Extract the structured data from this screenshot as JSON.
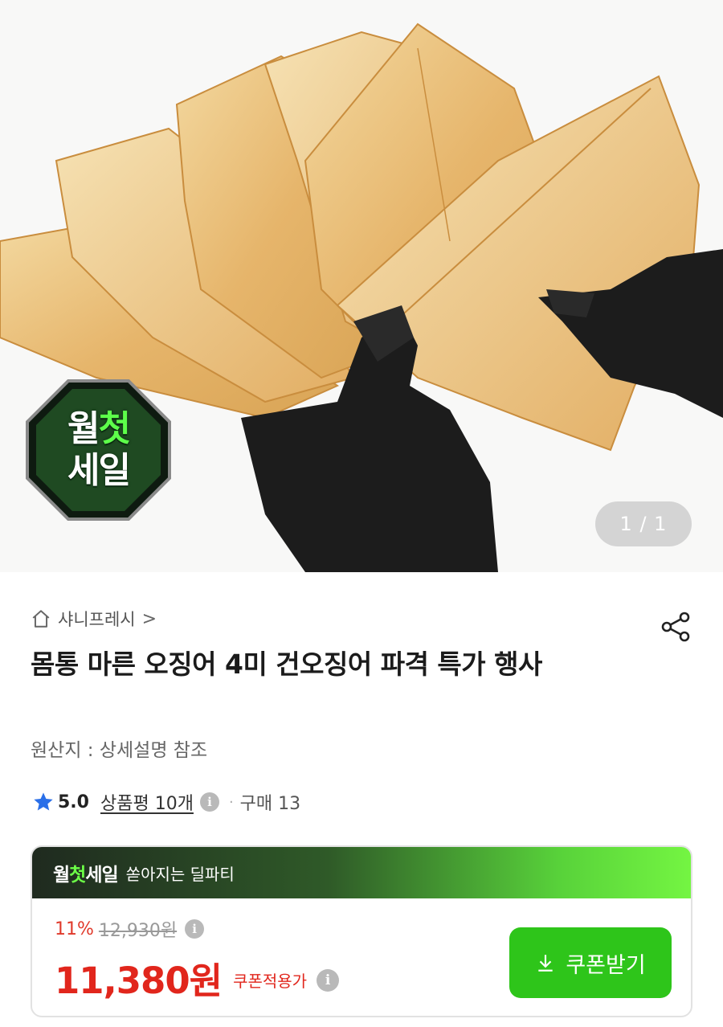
{
  "hero": {
    "badge": {
      "line1_a": "월",
      "line1_b": "첫",
      "line2": "세일"
    },
    "pager": "1 / 1"
  },
  "product": {
    "store_name": "샤니프레시",
    "store_chevron": ">",
    "title": "몸통 마른 오징어 4미 건오징어 파격 특가 행사",
    "origin": "원산지 : 상세설명 참조",
    "rating": {
      "score": "5.0",
      "reviews": "상품평 10개",
      "separator": "·",
      "purchases": "구매 13"
    }
  },
  "deal": {
    "logo_a": "월",
    "logo_b": "첫",
    "logo_c": "세일",
    "subtitle": "쏟아지는 딜파티",
    "discount_rate": "11%",
    "original_price": "12,930원",
    "price": "11,380원",
    "coupon_note": "쿠폰적용가",
    "coupon_button": "쿠폰받기"
  },
  "icons": {
    "home": "home-icon",
    "share": "share-icon",
    "star": "star-icon",
    "info": "info-icon",
    "download": "download-icon"
  },
  "colors": {
    "price_red": "#e1261c",
    "coupon_green": "#2ec51a",
    "star_blue": "#2a6fe8",
    "deal_header_start": "#1f2a1f",
    "deal_header_end": "#74f542"
  }
}
